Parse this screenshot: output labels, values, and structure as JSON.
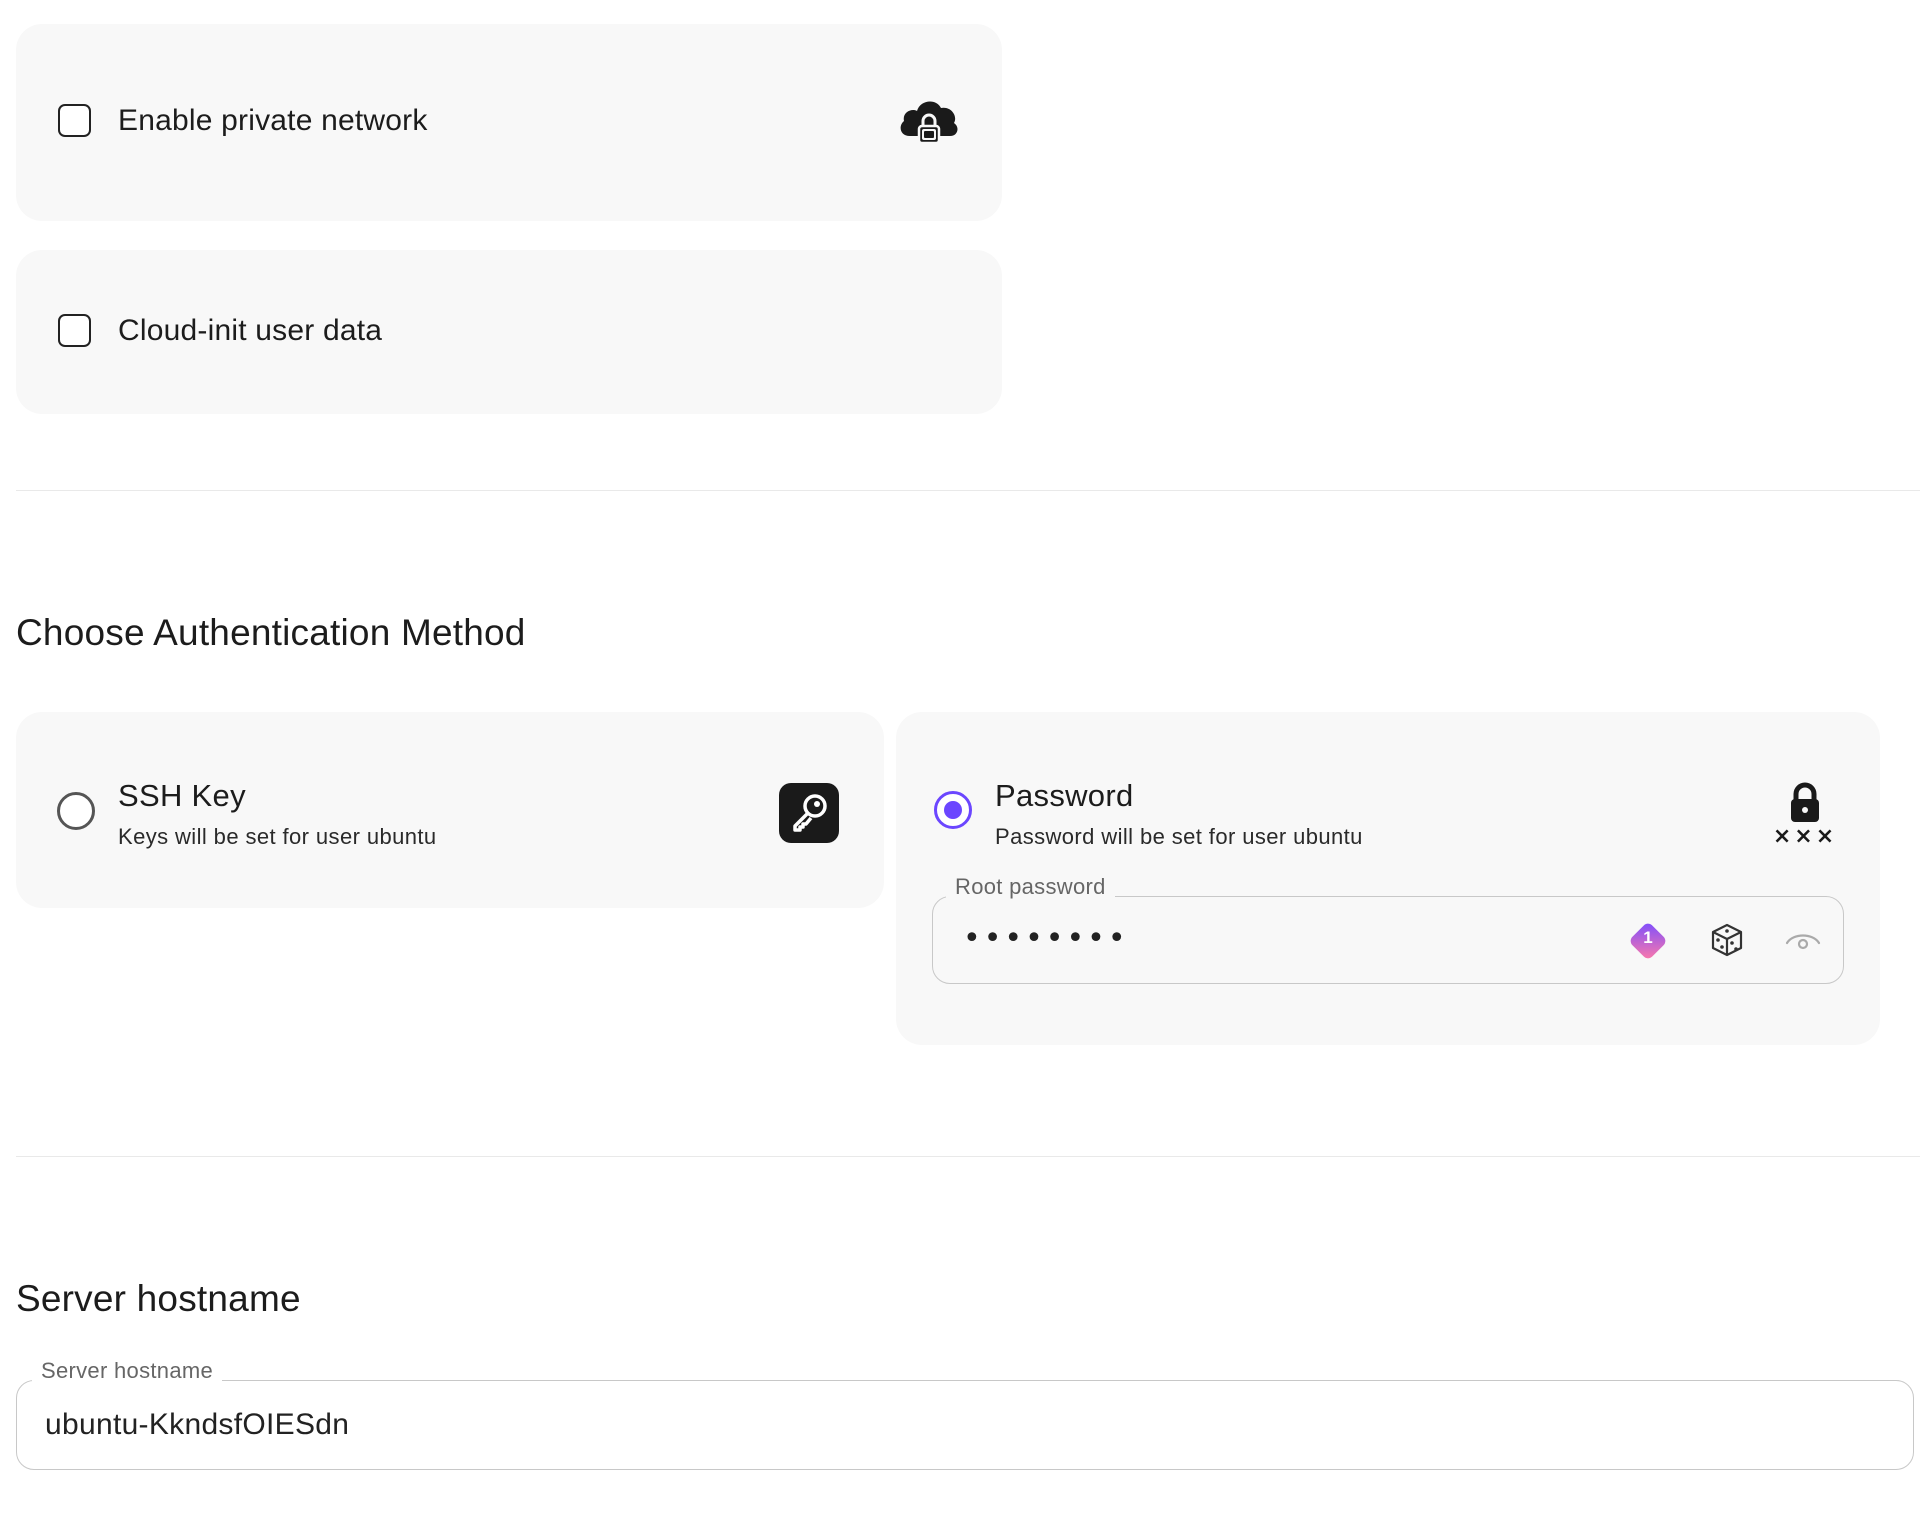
{
  "options": {
    "private_network": {
      "label": "Enable private network",
      "checked": false,
      "icon": "cloud-lock-icon"
    },
    "cloud_init": {
      "label": "Cloud-init user data",
      "checked": false
    }
  },
  "auth": {
    "title": "Choose Authentication Method",
    "ssh_key": {
      "title": "SSH Key",
      "subtitle": "Keys will be set for user ubuntu",
      "selected": false,
      "icon": "key-icon"
    },
    "password": {
      "title": "Password",
      "subtitle": "Password will be set for user ubuntu",
      "selected": true,
      "icon": "lock-password-icon",
      "icon_marks": "×××",
      "field_label": "Root password",
      "masked_value": "••••••••",
      "badge_text": "1",
      "tools": [
        "1password-icon",
        "dice-icon",
        "eye-icon"
      ]
    }
  },
  "hostname": {
    "title": "Server hostname",
    "field_label": "Server hostname",
    "value": "ubuntu-KkndsfOIESdn"
  },
  "colors": {
    "accent": "#6b46ff",
    "card_bg": "#f8f8f8",
    "border": "#c8c8c8"
  }
}
